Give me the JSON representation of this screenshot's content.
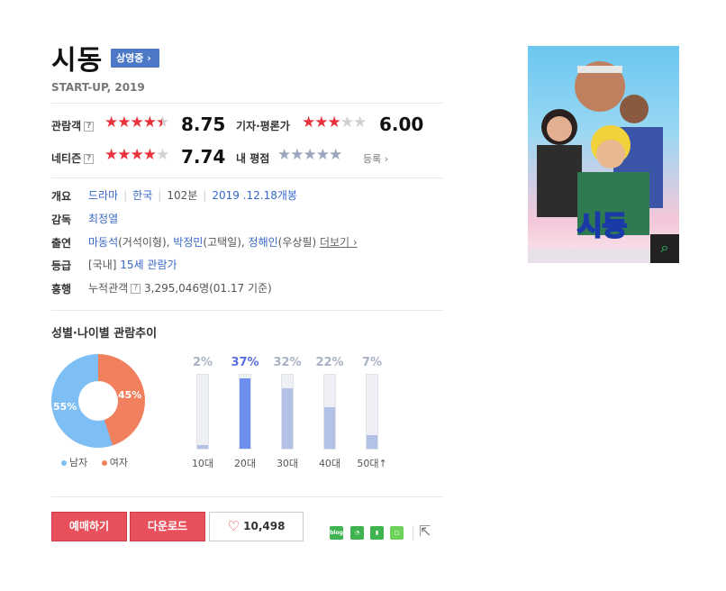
{
  "movie": {
    "title": "시동",
    "status": "상영중 ›",
    "subtitle": "START-UP, 2019"
  },
  "ratings": {
    "audience": {
      "label": "관람객",
      "score": "8.75",
      "stars": 4.5
    },
    "critic": {
      "label": "기자·평론가",
      "score": "6.00",
      "stars": 3
    },
    "netizen": {
      "label": "네티즌",
      "score": "7.74",
      "stars": 4
    },
    "mine": {
      "label": "내 평점",
      "register": "등록 ›"
    },
    "help": "?"
  },
  "info": {
    "overview_label": "개요",
    "genre": "드라마",
    "country": "한국",
    "runtime": "102분",
    "release": "2019 .12.18개봉",
    "director_label": "감독",
    "director": "최정열",
    "cast_label": "출연",
    "cast": [
      {
        "name": "마동석",
        "role": "(거석이형), "
      },
      {
        "name": "박정민",
        "role": "(고택일), "
      },
      {
        "name": "정해인",
        "role": "(우상필) "
      }
    ],
    "more": "더보기 ›",
    "grade_label": "등급",
    "grade_prefix": "[국내]",
    "grade": "15세 관람가",
    "boxoffice_label": "흥행",
    "boxoffice_prefix": "누적관객",
    "boxoffice": "3,295,046명(01.17 기준)"
  },
  "demographics": {
    "title": "성별·나이별 관람추이",
    "gender": {
      "male_pct": "55%",
      "female_pct": "45%",
      "male_label": "남자",
      "female_label": "여자",
      "male_color": "#7dbff5",
      "female_color": "#f1805f"
    },
    "ages": [
      {
        "label": "10대",
        "pct": "2%",
        "value": 2
      },
      {
        "label": "20대",
        "pct": "37%",
        "value": 37,
        "highlight": true
      },
      {
        "label": "30대",
        "pct": "32%",
        "value": 32
      },
      {
        "label": "40대",
        "pct": "22%",
        "value": 22
      },
      {
        "label": "50대",
        "pct": "7%",
        "value": 7,
        "suffix": "↑"
      }
    ]
  },
  "actions": {
    "reserve": "예매하기",
    "download": "다운로드",
    "likes": "10,498"
  },
  "share": [
    {
      "name": "blog-icon",
      "text": "blog",
      "color": "#3fb34f"
    },
    {
      "name": "band-icon",
      "text": "",
      "color": "#3fb34f"
    },
    {
      "name": "bookmark-icon",
      "text": "",
      "color": "#3fb34f"
    },
    {
      "name": "square-icon",
      "text": "",
      "color": "#6cd25a"
    }
  ],
  "poster": {
    "title": "시동"
  }
}
